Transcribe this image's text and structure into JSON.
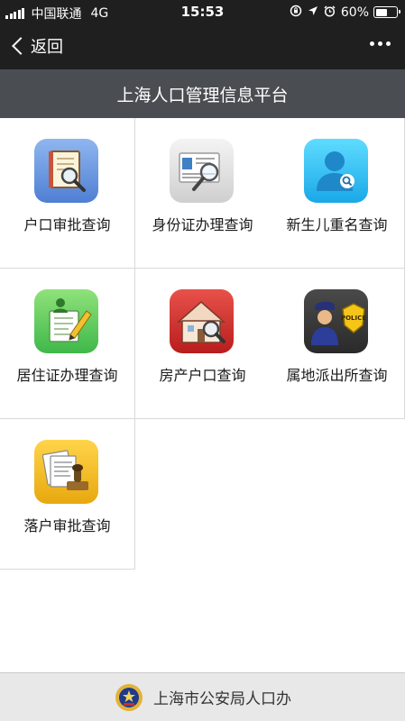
{
  "status_bar": {
    "carrier": "中国联通",
    "network": "4G",
    "time": "15:53",
    "battery_percent": "60%",
    "battery_level": 0.6,
    "icons": [
      "signal-icon",
      "orientation-lock-icon",
      "location-icon",
      "alarm-icon",
      "battery-icon"
    ]
  },
  "nav": {
    "back_label": "返回",
    "more_icon": "more-dots-icon"
  },
  "banner": {
    "title": "上海人口管理信息平台"
  },
  "services": [
    {
      "label": "户口审批查询",
      "icon": "book-magnifier-icon"
    },
    {
      "label": "身份证办理查询",
      "icon": "id-card-magnifier-icon"
    },
    {
      "label": "新生儿重名查询",
      "icon": "person-search-icon"
    },
    {
      "label": "居住证办理查询",
      "icon": "document-pencil-icon"
    },
    {
      "label": "房产户口查询",
      "icon": "house-magnifier-icon"
    },
    {
      "label": "属地派出所查询",
      "icon": "police-officer-icon"
    },
    {
      "label": "落户审批查询",
      "icon": "documents-stamp-icon"
    }
  ],
  "footer": {
    "text": "上海市公安局人口办",
    "icon": "police-emblem-icon"
  },
  "colors": {
    "status_bg": "#1f1f1f",
    "banner_bg": "#4a4d52",
    "footer_bg": "#e8e8e8"
  }
}
